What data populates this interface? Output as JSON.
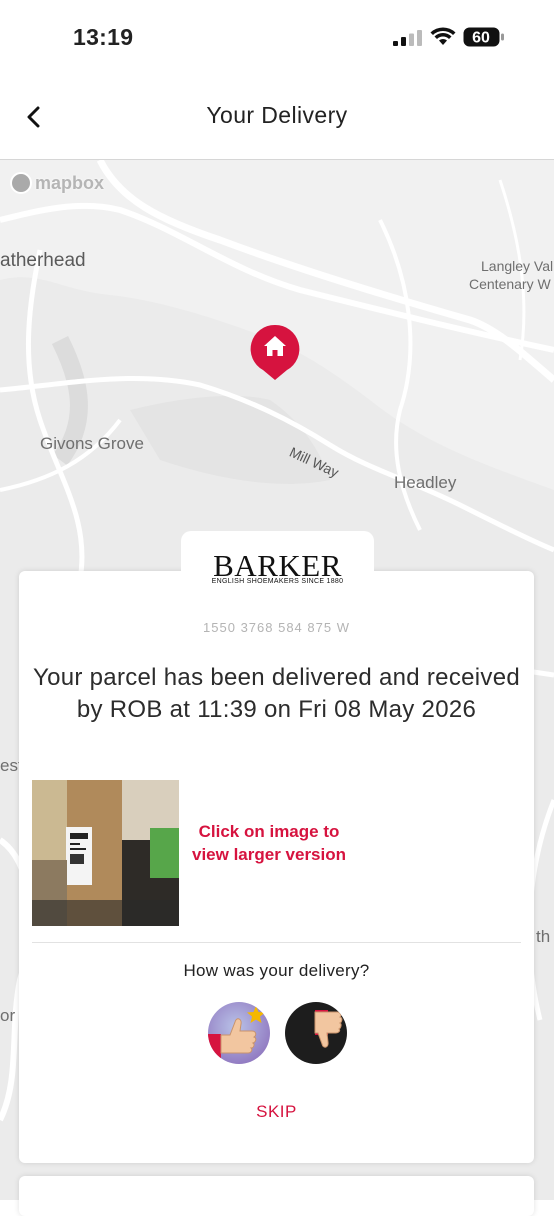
{
  "status_bar": {
    "time": "13:19",
    "battery": "60"
  },
  "header": {
    "title": "Your Delivery"
  },
  "map": {
    "attribution": "mapbox",
    "labels": {
      "leatherhead": "atherhead",
      "langley": "Langley Val",
      "centenary": "Centenary W",
      "givons": "Givons Grove",
      "millway": "Mill Way",
      "headley": "Headley",
      "edge_left_1": "estl",
      "edge_left_2": "or",
      "edge_right": "th"
    }
  },
  "delivery_card": {
    "brand_name": "BARKER",
    "brand_tagline": "ENGLISH SHOEMAKERS SINCE 1880",
    "tracking_number": "1550 3768 584 875 W",
    "message": "Your parcel has been delivered and received by ROB at 11:39 on Fri 08 May 2026",
    "photo_caption": "Click on image to view larger version",
    "feedback_question": "How was your delivery?",
    "skip_label": "SKIP"
  },
  "colors": {
    "accent": "#d6133f",
    "map_background": "#f1f1f1",
    "text": "#2c2c2c"
  }
}
